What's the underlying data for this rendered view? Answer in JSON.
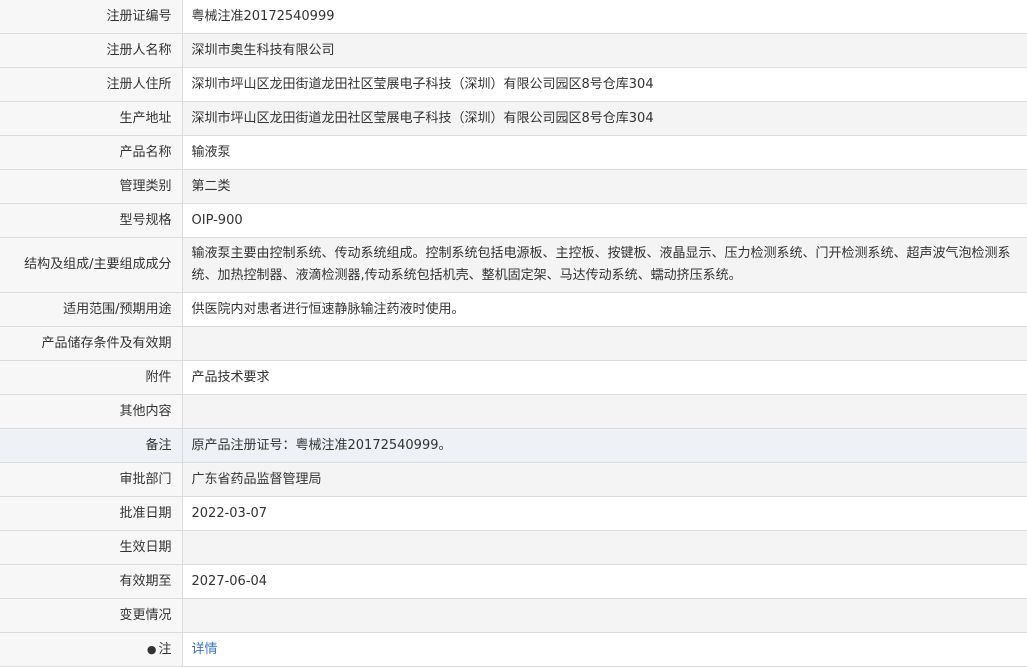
{
  "rows": [
    {
      "label": "注册证编号",
      "value": "粤械注准20172540999"
    },
    {
      "label": "注册人名称",
      "value": "深圳市奥生科技有限公司"
    },
    {
      "label": "注册人住所",
      "value": "深圳市坪山区龙田街道龙田社区莹展电子科技（深圳）有限公司园区8号仓库304"
    },
    {
      "label": "生产地址",
      "value": "深圳市坪山区龙田街道龙田社区莹展电子科技（深圳）有限公司园区8号仓库304"
    },
    {
      "label": "产品名称",
      "value": "输液泵"
    },
    {
      "label": "管理类别",
      "value": "第二类"
    },
    {
      "label": "型号规格",
      "value": "OIP-900"
    },
    {
      "label": "结构及组成/主要组成成分",
      "value": "输液泵主要由控制系统、传动系统组成。控制系统包括电源板、主控板、按键板、液晶显示、压力检测系统、门开检测系统、超声波气泡检测系统、加热控制器、液滴检测器,传动系统包括机壳、整机固定架、马达传动系统、蠕动挤压系统。"
    },
    {
      "label": "适用范围/预期用途",
      "value": "供医院内对患者进行恒速静脉输注药液时使用。"
    },
    {
      "label": "产品储存条件及有效期",
      "value": ""
    },
    {
      "label": "附件",
      "value": "产品技术要求"
    },
    {
      "label": "其他内容",
      "value": ""
    },
    {
      "label": "备注",
      "value": "原产品注册证号：粤械注准20172540999。"
    },
    {
      "label": "审批部门",
      "value": "广东省药品监督管理局"
    },
    {
      "label": "批准日期",
      "value": "2022-03-07"
    },
    {
      "label": "生效日期",
      "value": ""
    },
    {
      "label": "有效期至",
      "value": "2027-06-04"
    },
    {
      "label": "变更情况",
      "value": ""
    },
    {
      "label": "注",
      "value": "详情"
    }
  ],
  "colors": {
    "link": "#3b73c7",
    "label_bg": "#f7f7f7",
    "highlight_bg": "#eef1f6"
  }
}
